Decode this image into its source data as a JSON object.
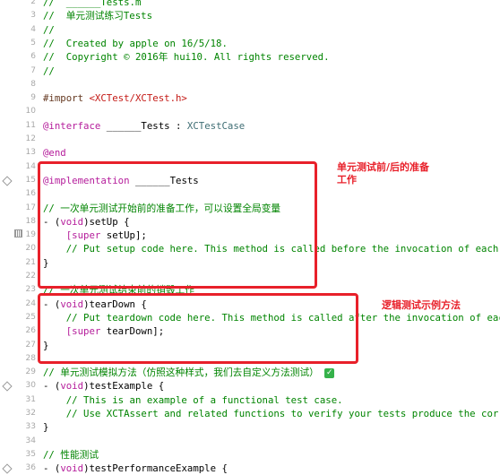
{
  "lines": [
    {
      "n": "2",
      "text": "//  ______Tests.m"
    },
    {
      "n": "3",
      "text": "//  单元测试练习Tests"
    },
    {
      "n": "4",
      "text": "//"
    },
    {
      "n": "5",
      "text": "//  Created by apple on 16/5/18."
    },
    {
      "n": "6",
      "text": "//  Copyright © 2016年 hui10. All rights reserved."
    },
    {
      "n": "7",
      "text": "//"
    },
    {
      "n": "8",
      "text": ""
    },
    {
      "n": "9",
      "pre": "#import ",
      "rest": "<XCTest/XCTest.h>"
    },
    {
      "n": "10",
      "text": ""
    },
    {
      "n": "11",
      "kw": "@interface",
      "mid": " ______Tests : ",
      "type": "XCTestCase"
    },
    {
      "n": "12",
      "text": ""
    },
    {
      "n": "13",
      "kw": "@end"
    },
    {
      "n": "14",
      "text": ""
    },
    {
      "n": "15",
      "kw": "@implementation",
      "mid": " ______Tests"
    },
    {
      "n": "16",
      "text": ""
    },
    {
      "n": "17",
      "comment": "// 一次单元测试开始前的准备工作，可以设置全局变量"
    },
    {
      "n": "18",
      "text": "- (void)setUp {"
    },
    {
      "n": "19",
      "kw": "    [super",
      "mid": " setUp];"
    },
    {
      "n": "20",
      "comment": "    // Put setup code here. This method is called before the invocation of each tes"
    },
    {
      "n": "21",
      "text": "}"
    },
    {
      "n": "22",
      "text": ""
    },
    {
      "n": "23",
      "comment": "// 一次单元测试结束前的销毁工作"
    },
    {
      "n": "24",
      "text": "- (void)tearDown {"
    },
    {
      "n": "25",
      "comment": "    // Put teardown code here. This method is called after the invocation of each t"
    },
    {
      "n": "26",
      "kw": "    [super",
      "mid": " tearDown];"
    },
    {
      "n": "27",
      "text": "}"
    },
    {
      "n": "28",
      "text": ""
    },
    {
      "n": "29",
      "comment": "// 单元测试模拟方法（仿照这种样式，我们去自定义方法测试）"
    },
    {
      "n": "30",
      "text": "- (void)testExample {"
    },
    {
      "n": "31",
      "comment": "    // This is an example of a functional test case."
    },
    {
      "n": "32",
      "comment": "    // Use XCTAssert and related functions to verify your tests produce the correct"
    },
    {
      "n": "33",
      "text": "}"
    },
    {
      "n": "34",
      "text": ""
    },
    {
      "n": "35",
      "comment": "// 性能测试"
    },
    {
      "n": "36",
      "text": "- (void)testPerformanceExample {"
    }
  ],
  "annotations": {
    "setup_teardown": "单元测试前/后的准备\n工作",
    "logic_test": "逻辑测试示例方法"
  },
  "checkmark": "✓",
  "colors": {
    "annotation_red": "#e8202a",
    "comment_green": "#008400",
    "keyword_purple": "#b51d9b"
  }
}
